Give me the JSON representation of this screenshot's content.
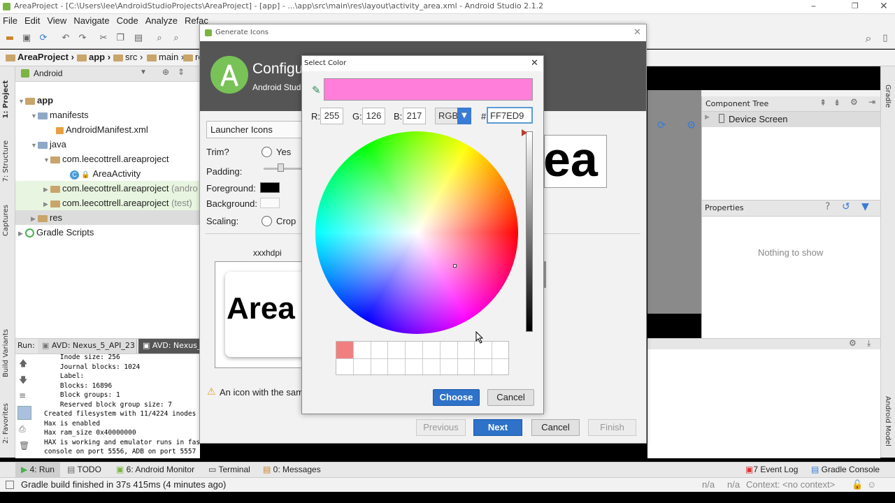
{
  "window": {
    "title": "AreaProject - [C:\\Users\\lee\\AndroidStudioProjects\\AreaProject] - [app] - ...\\app\\src\\main\\res\\layout\\activity_area.xml - Android Studio 2.1.2"
  },
  "menu": [
    "File",
    "Edit",
    "View",
    "Navigate",
    "Code",
    "Analyze",
    "Refac"
  ],
  "breadcrumbs": [
    "AreaProject",
    "app",
    "src",
    "main",
    "re"
  ],
  "left_tools": [
    "1: Project",
    "7: Structure",
    "Captures",
    "Build Variants",
    "2: Favorites"
  ],
  "right_tools": [
    "Gradle",
    "Android Model"
  ],
  "project": {
    "view_selector": "Android",
    "tree": [
      {
        "label": "app",
        "bold": true
      },
      {
        "label": "manifests"
      },
      {
        "label": "AndroidManifest.xml"
      },
      {
        "label": "java"
      },
      {
        "label": "com.leecottrell.areaproject"
      },
      {
        "label": "AreaActivity"
      },
      {
        "label": "com.leecottrell.areaproject",
        "suffix": "(andro"
      },
      {
        "label": "com.leecottrell.areaproject",
        "suffix": "(test)"
      },
      {
        "label": "res"
      },
      {
        "label": "Gradle Scripts"
      }
    ]
  },
  "run": {
    "label": "Run:",
    "tabs": [
      "AVD: Nexus_5_API_23",
      "AVD: Nexus_5_"
    ],
    "log": [
      "    Inode size: 256",
      "    Journal blocks: 1024",
      "    Label:",
      "    Blocks: 16896",
      "    Block groups: 1",
      "    Reserved block group size: 7",
      "Created filesystem with 11/4224 inodes a",
      "Hax is enabled",
      "Hax ram_size 0x40000000",
      "HAX is working and emulator runs in fast",
      "console on port 5556, ADB on port 5557"
    ]
  },
  "component_tree": {
    "title": "Component Tree",
    "item": "Device Screen"
  },
  "properties": {
    "title": "Properties",
    "empty": "Nothing to show"
  },
  "bottom_tabs": [
    "4: Run",
    "TODO",
    "6: Android Monitor",
    "Terminal",
    "0: Messages"
  ],
  "bottom_right_tabs": [
    "7 Event Log",
    "Gradle Console"
  ],
  "status": {
    "message": "Gradle build finished in 37s 415ms (4 minutes ago)",
    "right": [
      "n/a",
      "n/a",
      "Context: <no context>"
    ]
  },
  "generate_icons": {
    "title": "Generate Icons",
    "banner_title": "Configu",
    "banner_sub": "Android Studi",
    "asset_type": "Launcher Icons",
    "trim_label": "Trim?",
    "trim_yes": "Yes",
    "padding_label": "Padding:",
    "foreground_label": "Foreground:",
    "background_label": "Background:",
    "scaling_label": "Scaling:",
    "scaling_crop": "Crop",
    "density": "xxxhdpi",
    "preview_text": "Area",
    "preview_right_text": "ea",
    "warning": "An icon with the sam",
    "buttons": {
      "previous": "Previous",
      "next": "Next",
      "cancel": "Cancel",
      "finish": "Finish"
    }
  },
  "select_color": {
    "title": "Select Color",
    "r_label": "R:",
    "r": "255",
    "g_label": "G:",
    "g": "126",
    "b_label": "B:",
    "b": "217",
    "mode": "RGB",
    "hash": "#",
    "hex": "FF7ED9",
    "preview_color": "#ff7ed9",
    "recent_color": "#f08080",
    "choose": "Choose",
    "cancel": "Cancel"
  }
}
